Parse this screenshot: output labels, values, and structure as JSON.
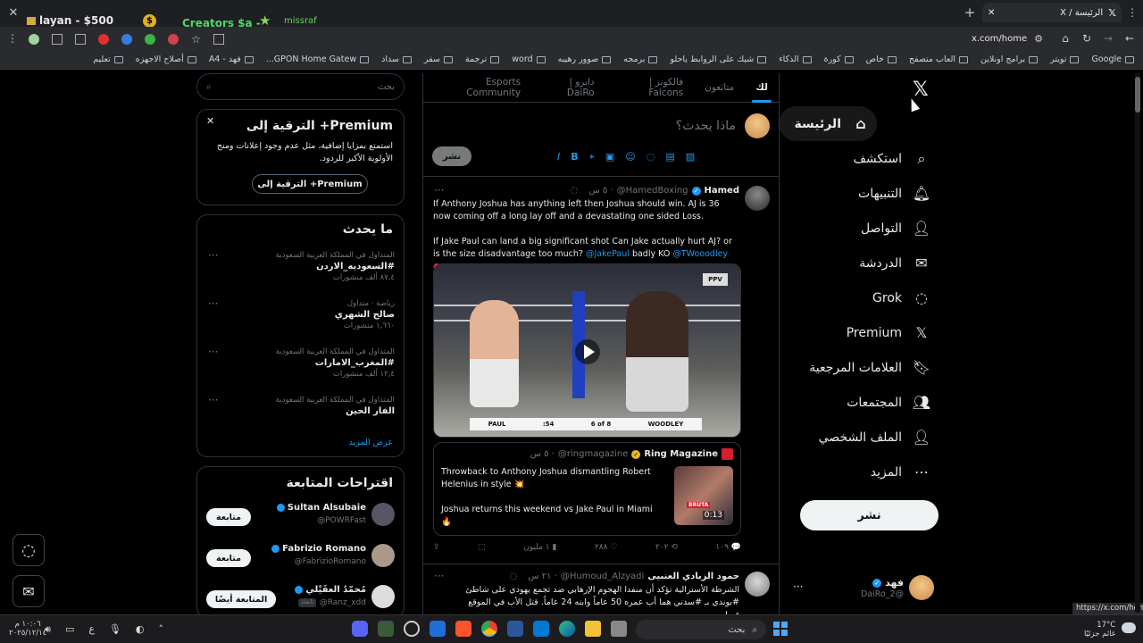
{
  "browser": {
    "tab_title": "الرئيسة / X",
    "tab_left_label": "layan - $500",
    "tab_left_label2": "Creators $a -",
    "tab_left_label3": "missraf",
    "url": "x.com/home",
    "status_url": "https://x.com/home",
    "bookmarks": [
      "Google",
      "تويتر",
      "برامج اونلاين",
      "العاب متصفح",
      "خاص",
      "كورة",
      "الذكاء",
      "شيك على الروابط ياحلو",
      "برمجه",
      "صوور رهيبه",
      "word",
      "ترجمة",
      "سفر",
      "سداد",
      "GPON Home Gatew...",
      "فهد - A4",
      "أصلاح الاجهزه",
      "تعليم"
    ]
  },
  "nav": {
    "items": [
      "الرئيسة",
      "استكشف",
      "التنبيهات",
      "التواصل",
      "الدردشة",
      "Grok",
      "Premium",
      "العلامات المرجعية",
      "المجتمعات",
      "الملف الشخصي",
      "المزيد"
    ],
    "post_button": "نشر",
    "profile_name": "فهد",
    "profile_handle": "@DaiRo_2"
  },
  "feed": {
    "tabs": [
      "لك",
      "متابَعون",
      "فالكونز | Falcons",
      "دايرو | DaiRo",
      "Esports Community"
    ],
    "compose_placeholder": "ماذا يحدث؟",
    "compose_button": "نشر",
    "tweet1": {
      "name": "Hamed",
      "handle": "@HamedBoxing",
      "time": "· ٥ س",
      "text1": "If Anthony Joshua has anything left then Joshua should win. AJ is 36 now coming off a long lay off and a devastating one sided Loss.",
      "text2a": "If Jake Paul can land a big significant shot Can Jake actually hurt AJ? or is the size disadvantage too much?",
      "mention1": "@JakePaul",
      "text2b": "badly KO",
      "mention2": "@TWooodley",
      "scoreboard": [
        "PAUL",
        ":54",
        "6 of 8",
        "WOODLEY"
      ],
      "quote_name": "Ring Magazine",
      "quote_handle": "@ringmagazine",
      "quote_time": "· ٥ س",
      "quote_text1": "Throwback to Anthony Joshua dismantling Robert Helenius in style 💥",
      "quote_text2": "Joshua returns this weekend vs Jake Paul in Miami 🔥",
      "quote_duration": "0:13",
      "quote_thumb_label": "BRUTA",
      "stats": {
        "replies": "١٠٩",
        "reposts": "٢٠٢",
        "likes": "٢٨٨",
        "views": "١ مليون"
      }
    },
    "tweet2": {
      "name": "حمود الزبادي العنبيى",
      "handle": "@Humoud_Alzyadi",
      "time": "· ٢١ س",
      "text": "الشرطة الأسترالية تؤكد أن منفذا الهجوم الإرهابي ضد تجمع يهودي على شاطئ #بوندي بـ #سدني هما أب عمره 50 عاماً وابنه 24 عاماً. قتل الأب في الموقع فيما"
    }
  },
  "sidebar": {
    "search_placeholder": "بحث",
    "premium_title": "Premium+ الترقية إلى",
    "premium_text": "استمتع بمزايا إضافية، مثل عدم وجود إعلانات ومنح الأولوية الأكبر للردود.",
    "premium_button": "Premium+ الترقية إلى",
    "trends_title": "ما يحدث",
    "trends": [
      {
        "context": "المتداول في المملكة العربية السعودية",
        "name": "#السعوديه_الاردن",
        "count": "٨٧,٤ ألف منشورات"
      },
      {
        "context": "رياضة · متداول",
        "name": "صالح الشهري",
        "count": "١,٦٦٠ منشورات"
      },
      {
        "context": "المتداول في المملكة العربية السعودية",
        "name": "#المغرب_الامارات",
        "count": "١٢,٤ ألف منشورات"
      },
      {
        "context": "المتداول في المملكة العربية السعودية",
        "name": "الفار الحين",
        "count": ""
      }
    ],
    "show_more": "عرض المزيد",
    "follow_title": "اقتراحات المتابعة",
    "follow": [
      {
        "name": "Sultan Alsubaie",
        "handle": "@POWRFast",
        "button": "متابعة"
      },
      {
        "name": "Fabrizio Romano",
        "handle": "@FabrizioRomano",
        "button": "متابعة"
      },
      {
        "name": "مُحمّدُ العقَيْلي",
        "handle": "@Ranz_xdd",
        "button": "المتابعة أيضًا",
        "badge": "تابَعك"
      }
    ]
  },
  "taskbar": {
    "search": "بحث",
    "weather_temp": "17°C",
    "weather_desc": "غائم جزئيًا",
    "time": "١٠:٠٦ م",
    "date": "٢٠٢٥/١٢/١٤",
    "lang": "ع"
  }
}
